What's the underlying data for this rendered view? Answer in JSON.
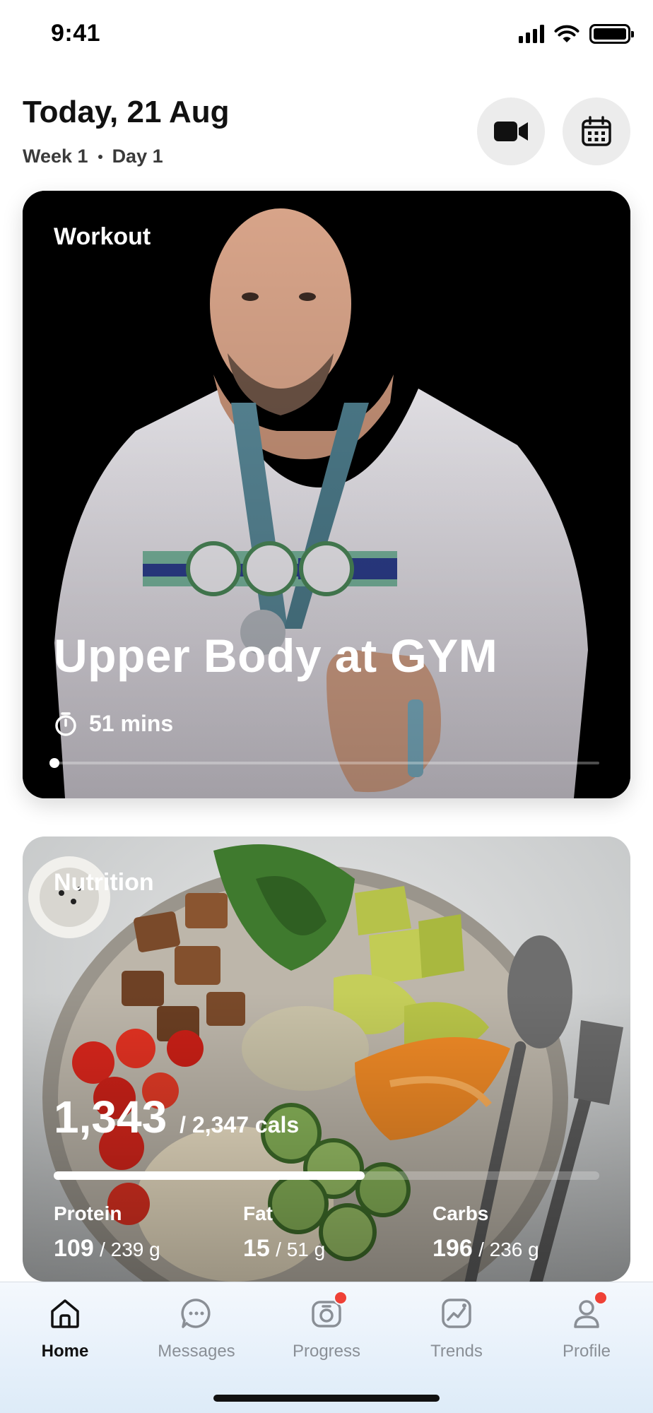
{
  "status_bar": {
    "time": "9:41"
  },
  "header": {
    "title": "Today, 21 Aug",
    "week": "Week 1",
    "day": "Day 1"
  },
  "workout": {
    "label": "Workout",
    "title": "Upper Body at GYM",
    "duration": "51 mins",
    "progress": 0.0
  },
  "nutrition": {
    "label": "Nutrition",
    "calories_eaten": "1,343",
    "calories_total": "/ 2,347 cals",
    "progress": 0.57,
    "macros": [
      {
        "label": "Protein",
        "value": "109",
        "target": "/ 239 g"
      },
      {
        "label": "Fat",
        "value": "15",
        "target": "/ 51 g"
      },
      {
        "label": "Carbs",
        "value": "196",
        "target": "/ 236 g"
      }
    ]
  },
  "tabs": [
    {
      "label": "Home",
      "icon": "home-icon",
      "active": true,
      "badge": false
    },
    {
      "label": "Messages",
      "icon": "chat-icon",
      "active": false,
      "badge": false
    },
    {
      "label": "Progress",
      "icon": "camera-progress-icon",
      "active": false,
      "badge": true
    },
    {
      "label": "Trends",
      "icon": "trend-chart-icon",
      "active": false,
      "badge": false
    },
    {
      "label": "Profile",
      "icon": "profile-icon",
      "active": false,
      "badge": true
    }
  ],
  "colors": {
    "badge": "#ef4136",
    "accent_text": "#111111",
    "muted_text": "#8a8f96"
  }
}
